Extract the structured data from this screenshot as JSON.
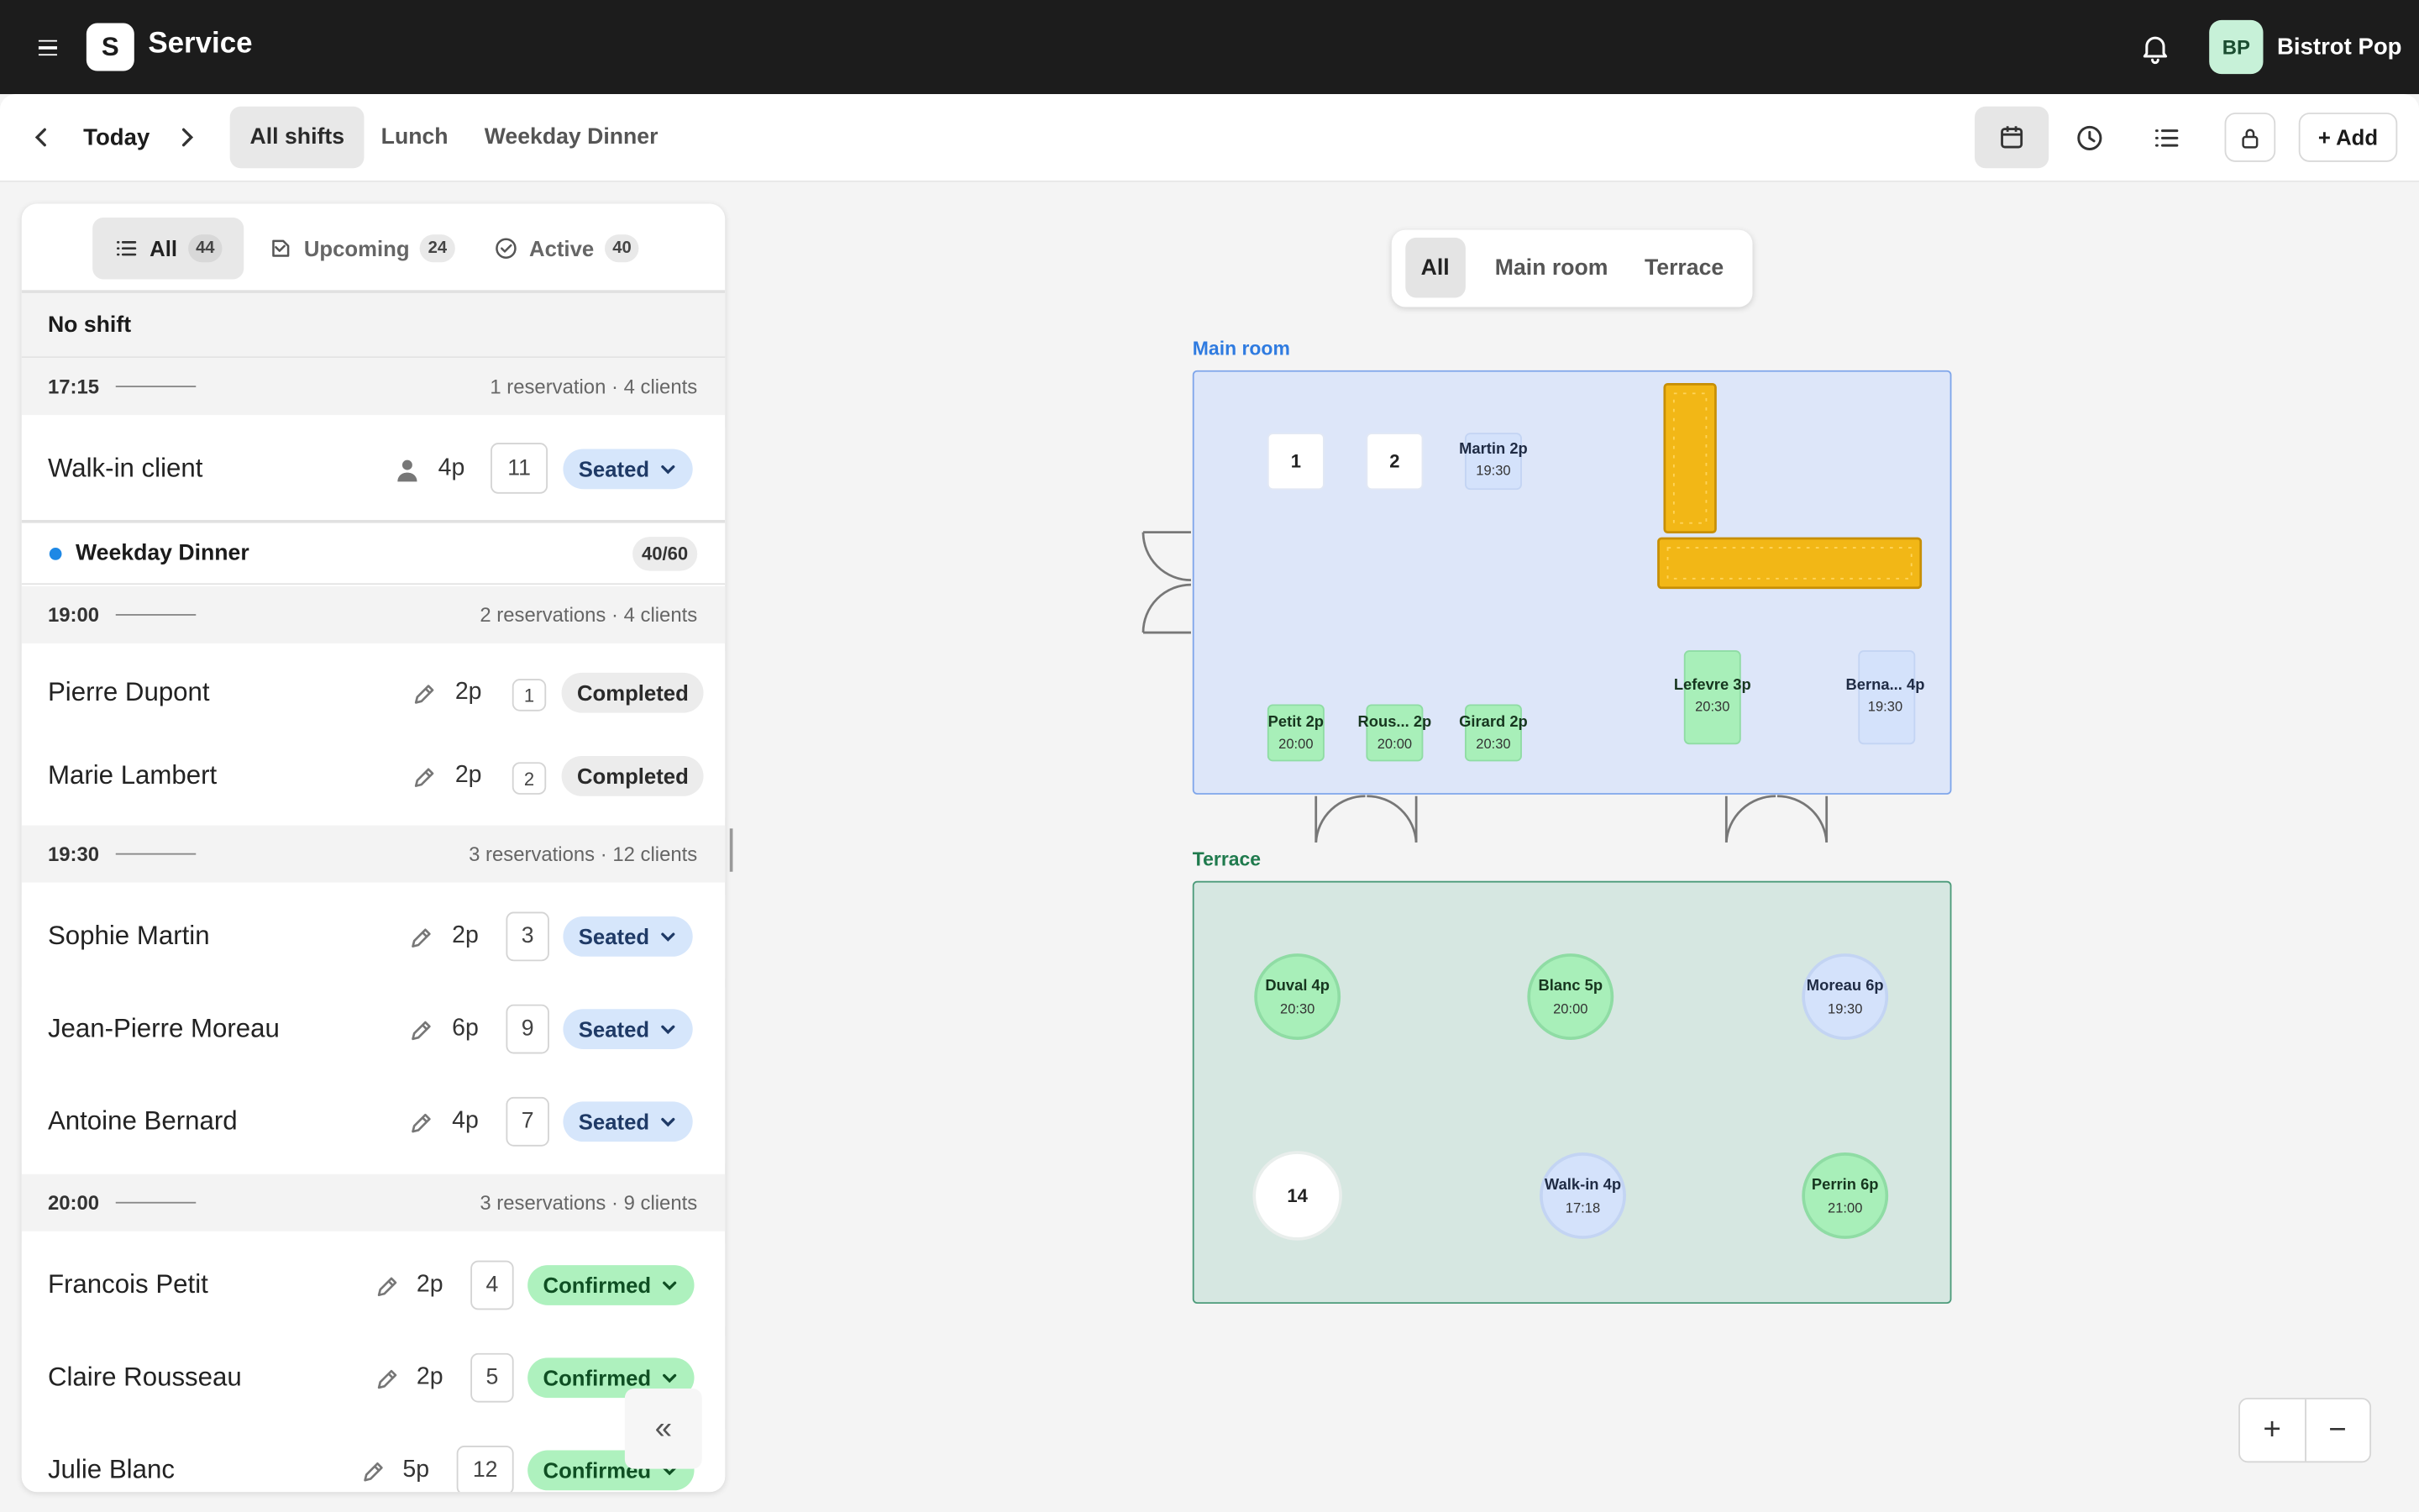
{
  "app": {
    "logo_letter": "S",
    "title": "Service",
    "org_initials": "BP",
    "org_name": "Bistrot Pop"
  },
  "toolbar": {
    "date_label": "Today",
    "shift_tabs": [
      "All shifts",
      "Lunch",
      "Weekday Dinner"
    ],
    "selected_shift": "All shifts",
    "views": [
      "calendar-icon",
      "clock-icon",
      "list-icon"
    ],
    "add_label": "+ Add"
  },
  "filters": [
    {
      "label": "All",
      "count": "44",
      "icon": "list-icon",
      "active": true
    },
    {
      "label": "Upcoming",
      "count": "24",
      "icon": "incoming-icon",
      "active": false
    },
    {
      "label": "Active",
      "count": "40",
      "icon": "check-circle-icon",
      "active": false
    }
  ],
  "list": {
    "no_shift_label": "No shift",
    "slots": [
      {
        "time": "17:15",
        "summary": "1 reservation · 4 clients"
      },
      {
        "time": "19:00",
        "summary": "2 reservations · 4 clients"
      },
      {
        "time": "19:30",
        "summary": "3 reservations · 12 clients"
      },
      {
        "time": "20:00",
        "summary": "3 reservations · 9 clients"
      }
    ],
    "shift": {
      "name": "Weekday Dinner",
      "capacity": "40/60"
    },
    "reservations": [
      {
        "name": "Walk-in client",
        "party": "4p",
        "table": "11",
        "status": "Seated",
        "icon": "person-icon"
      },
      {
        "name": "Pierre Dupont",
        "party": "2p",
        "table": "1",
        "status": "Completed",
        "icon": "pencil-icon"
      },
      {
        "name": "Marie Lambert",
        "party": "2p",
        "table": "2",
        "status": "Completed",
        "icon": "pencil-icon"
      },
      {
        "name": "Sophie Martin",
        "party": "2p",
        "table": "3",
        "status": "Seated",
        "icon": "pencil-icon"
      },
      {
        "name": "Jean-Pierre Moreau",
        "party": "6p",
        "table": "9",
        "status": "Seated",
        "icon": "pencil-icon"
      },
      {
        "name": "Antoine Bernard",
        "party": "4p",
        "table": "7",
        "status": "Seated",
        "icon": "pencil-icon"
      },
      {
        "name": "Francois Petit",
        "party": "2p",
        "table": "4",
        "status": "Confirmed",
        "icon": "pencil-icon"
      },
      {
        "name": "Claire Rousseau",
        "party": "2p",
        "table": "5",
        "status": "Confirmed",
        "icon": "pencil-icon"
      },
      {
        "name": "Julie Blanc",
        "party": "5p",
        "table": "12",
        "status": "Confirmed",
        "icon": "pencil-icon"
      }
    ],
    "collapse_icon": "«"
  },
  "floor": {
    "room_tabs": [
      "All",
      "Main room",
      "Terrace"
    ],
    "selected_room": "All",
    "colors": {
      "main_room_fill": "#dde6f9",
      "main_room_border": "#7fa6ea",
      "terrace_fill": "#d6e7e1",
      "terrace_border": "#4c9b7a",
      "bar": "#f2b716",
      "table_confirmed": "#a8efb9",
      "table_seated": "#d4e2fb",
      "table_free": "#ffffff"
    },
    "rooms": [
      {
        "name": "Main room",
        "label_color": "#2f7be0"
      },
      {
        "name": "Terrace",
        "label_color": "#1f7a4d"
      }
    ],
    "tables": [
      {
        "label": "1",
        "time": "",
        "state": "free"
      },
      {
        "label": "2",
        "time": "",
        "state": "free"
      },
      {
        "label": "Martin 2p",
        "time": "19:30",
        "state": "seated"
      },
      {
        "label": "Lefevre 3p",
        "time": "20:30",
        "state": "confirmed"
      },
      {
        "label": "Berna... 4p",
        "time": "19:30",
        "state": "seated"
      },
      {
        "label": "Petit 2p",
        "time": "20:00",
        "state": "confirmed"
      },
      {
        "label": "Rous... 2p",
        "time": "20:00",
        "state": "confirmed"
      },
      {
        "label": "Girard 2p",
        "time": "20:30",
        "state": "confirmed"
      },
      {
        "label": "Duval 4p",
        "time": "20:30",
        "state": "confirmed"
      },
      {
        "label": "Blanc 5p",
        "time": "20:00",
        "state": "confirmed"
      },
      {
        "label": "Moreau 6p",
        "time": "19:30",
        "state": "seated"
      },
      {
        "label": "14",
        "time": "",
        "state": "free"
      },
      {
        "label": "Walk-in 4p",
        "time": "17:18",
        "state": "seated"
      },
      {
        "label": "Perrin 6p",
        "time": "21:00",
        "state": "confirmed"
      }
    ],
    "zoom_in": "+",
    "zoom_out": "−"
  }
}
